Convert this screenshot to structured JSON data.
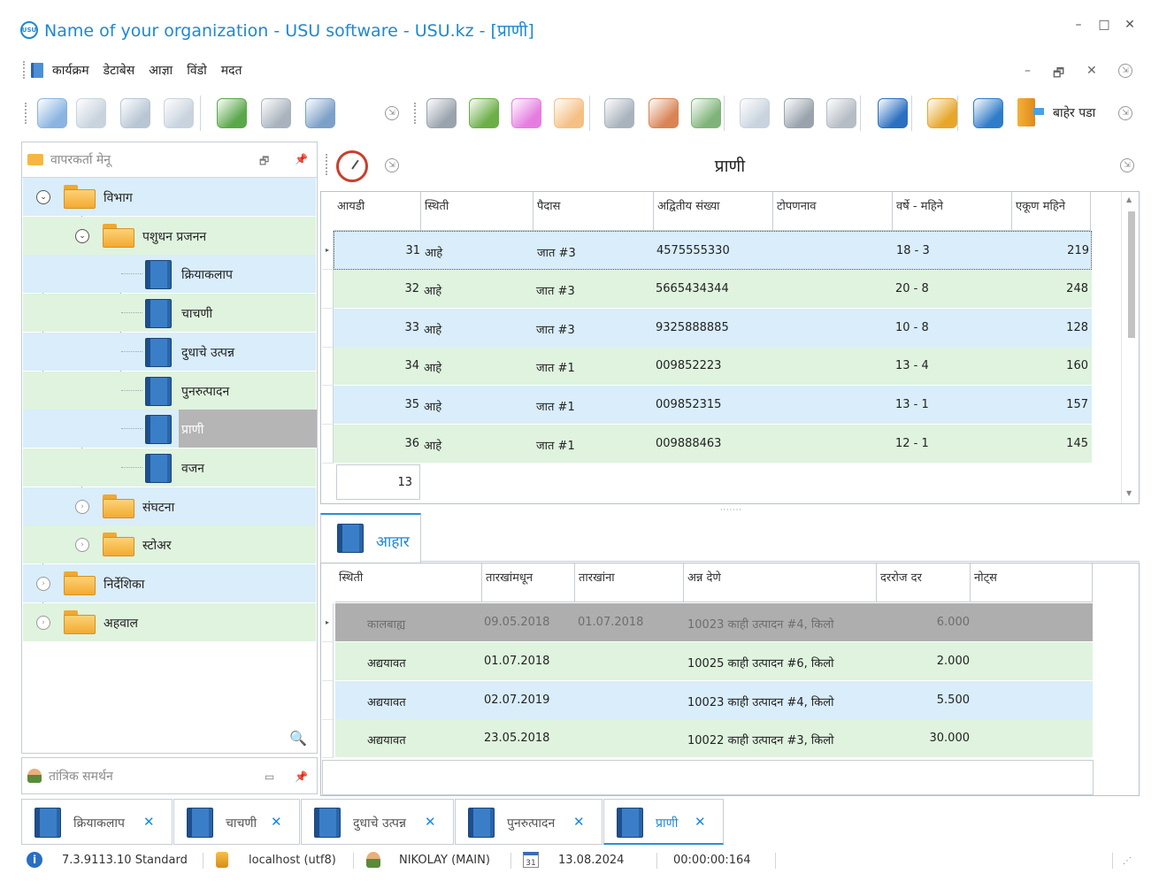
{
  "window": {
    "logo_text": "USU",
    "title": "Name of your organization - USU software - USU.kz - [प्राणी]",
    "controls": {
      "minimize": "–",
      "maximize": "□",
      "close": "✕"
    }
  },
  "menu": {
    "items": [
      "कार्यक्रम",
      "डेटाबेस",
      "आज्ञा",
      "विंडो",
      "मदत"
    ],
    "mdi_controls": {
      "minimize": "–",
      "restore": "🗗",
      "close": "✕"
    }
  },
  "toolbar": {
    "buttons": [
      {
        "name": "add-icon",
        "color": "#8bb4e0"
      },
      {
        "name": "copy-icon",
        "color": "#c9d3de"
      },
      {
        "name": "edit-icon",
        "color": "#b8c6d4"
      },
      {
        "name": "delete-icon",
        "color": "#c9d3de"
      },
      {
        "name": "refresh-icon",
        "color": "#5aa84a"
      },
      {
        "name": "search-icon",
        "color": "#aab3bd"
      },
      {
        "name": "advanced-search-icon",
        "color": "#7da0c8"
      },
      {
        "name": "settings-icon",
        "color": "#9aa3ad"
      },
      {
        "name": "map-icon",
        "color": "#6cae47"
      },
      {
        "name": "color-wheel-icon",
        "color": "#e57de0"
      },
      {
        "name": "hand-icon",
        "color": "#f4c084"
      },
      {
        "name": "rss-icon",
        "color": "#aab3bd"
      },
      {
        "name": "user-key-icon",
        "color": "#d88455"
      },
      {
        "name": "users-icon",
        "color": "#7fb37a"
      },
      {
        "name": "table-icon",
        "color": "#c9d3de"
      },
      {
        "name": "printer-icon",
        "color": "#9aa3ad"
      },
      {
        "name": "forward-icon",
        "color": "#b5bcc4"
      },
      {
        "name": "info-icon",
        "color": "#2a6fc0"
      },
      {
        "name": "lock-icon",
        "color": "#e6a72b"
      },
      {
        "name": "plug-icon",
        "color": "#2f7cc9"
      }
    ],
    "exit_label": "बाहेर पडा"
  },
  "sidebar": {
    "header": "वापरकर्ता मेनू",
    "tree": [
      {
        "label": "विभाग"
      },
      {
        "label": "पशुधन प्रजनन"
      },
      {
        "label": "क्रियाकलाप"
      },
      {
        "label": "चाचणी"
      },
      {
        "label": "दुधाचे उत्पन्न"
      },
      {
        "label": "पुनरुत्पादन"
      },
      {
        "label": "प्राणी"
      },
      {
        "label": "वजन"
      },
      {
        "label": "संघटना"
      },
      {
        "label": "स्टोअर"
      },
      {
        "label": "निर्देशिका"
      },
      {
        "label": "अहवाल"
      }
    ],
    "tech_support": "तांत्रिक समर्थन"
  },
  "main": {
    "title": "प्राणी",
    "grid": {
      "columns": [
        "आयडी",
        "स्थिती",
        "पैदास",
        "अद्वितीय संख्या",
        "टोपणनाव",
        "वर्षे - महिने",
        "एकूण महिने"
      ],
      "rows": [
        {
          "id": "31",
          "status": "आहे",
          "breed": "जात #3",
          "number": "4575555330",
          "nick": "",
          "ym": "18 - 3",
          "total": "219"
        },
        {
          "id": "32",
          "status": "आहे",
          "breed": "जात #3",
          "number": "5665434344",
          "nick": "",
          "ym": "20 - 8",
          "total": "248"
        },
        {
          "id": "33",
          "status": "आहे",
          "breed": "जात #3",
          "number": "9325888885",
          "nick": "",
          "ym": "10 - 8",
          "total": "128"
        },
        {
          "id": "34",
          "status": "आहे",
          "breed": "जात #1",
          "number": "009852223",
          "nick": "",
          "ym": "13 - 4",
          "total": "160"
        },
        {
          "id": "35",
          "status": "आहे",
          "breed": "जात #1",
          "number": "009852315",
          "nick": "",
          "ym": "13 - 1",
          "total": "157"
        },
        {
          "id": "36",
          "status": "आहे",
          "breed": "जात #1",
          "number": "009888463",
          "nick": "",
          "ym": "12 - 1",
          "total": "145"
        }
      ],
      "footer_count": "13"
    },
    "detail_tab": "आहार",
    "detail_grid": {
      "columns": [
        "स्थिती",
        "तारखांमधून",
        "तारखांना",
        "अन्न देणे",
        "दररोज दर",
        "नोट्स"
      ],
      "rows": [
        {
          "status": "कालबाह्य",
          "from": "09.05.2018",
          "to": "01.07.2018",
          "food": "10023 काही उत्पादन #4, किलो",
          "rate": "6.000",
          "notes": ""
        },
        {
          "status": "अद्ययावत",
          "from": "01.07.2018",
          "to": "",
          "food": "10025 काही उत्पादन #6, किलो",
          "rate": "2.000",
          "notes": ""
        },
        {
          "status": "अद्ययावत",
          "from": "02.07.2019",
          "to": "",
          "food": "10023 काही उत्पादन #4, किलो",
          "rate": "5.500",
          "notes": ""
        },
        {
          "status": "अद्ययावत",
          "from": "23.05.2018",
          "to": "",
          "food": "10022 काही उत्पादन #3, किलो",
          "rate": "30.000",
          "notes": ""
        }
      ]
    }
  },
  "doc_tabs": [
    {
      "label": "क्रियाकलाप"
    },
    {
      "label": "चाचणी"
    },
    {
      "label": "दुधाचे उत्पन्न"
    },
    {
      "label": "पुनरुत्पादन"
    },
    {
      "label": "प्राणी"
    }
  ],
  "status_bar": {
    "version": "7.3.9113.10 Standard",
    "db": "localhost (utf8)",
    "user": "NIKOLAY (MAIN)",
    "calendar_day": "31",
    "date": "13.08.2024",
    "timer": "00:00:00:164"
  }
}
